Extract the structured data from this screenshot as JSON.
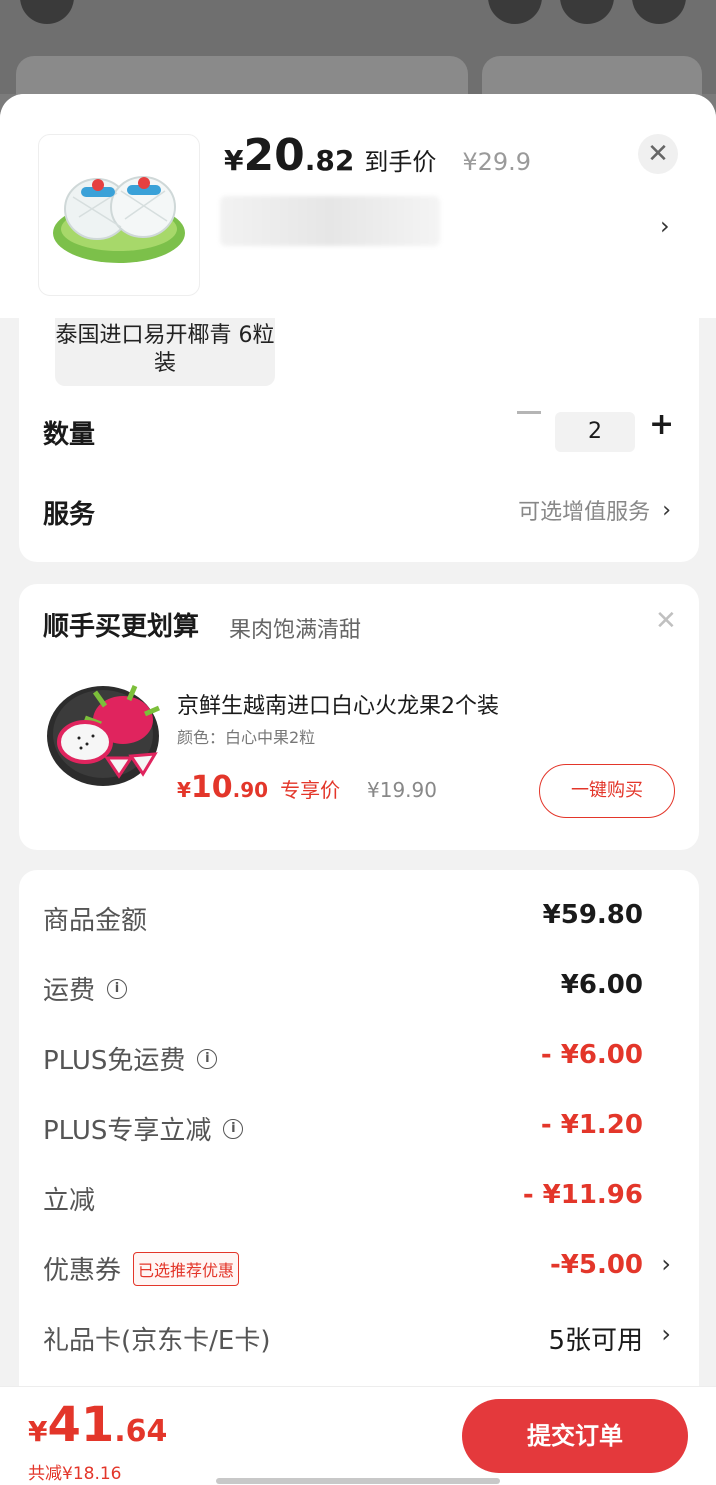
{
  "product": {
    "price_int": "20",
    "price_decimal": ".82",
    "price_currency": "¥",
    "price_desc": "到手价",
    "original_price": "¥29.9",
    "spec": "泰国进口易开椰青 6粒装"
  },
  "order": {
    "quantity_label": "数量",
    "quantity_value": "2",
    "service_label": "服务",
    "service_value": "可选增值服务"
  },
  "recommend": {
    "title": "顺手买更划算",
    "subtitle": "果肉饱满清甜",
    "item_name": "京鲜生越南进口白心火龙果2个装",
    "item_color": "颜色：白心中果2粒",
    "price_currency": "¥",
    "price_int": "10",
    "price_decimal": ".90",
    "price_tag": "专享价",
    "original_price": "¥19.90",
    "buy_label": "一键购买"
  },
  "fees": {
    "goods_label": "商品金额",
    "goods_value": "¥59.80",
    "shipping_label": "运费",
    "shipping_value": "¥6.00",
    "plus_free_label": "PLUS免运费",
    "plus_free_value": "- ¥6.00",
    "plus_discount_label": "PLUS专享立减",
    "plus_discount_value": "- ¥1.20",
    "discount_label": "立减",
    "discount_value": "- ¥11.96",
    "coupon_label": "优惠券",
    "coupon_tag": "已选推荐优惠",
    "coupon_value": "-¥5.00",
    "giftcard_label": "礼品卡(京东卡/E卡)",
    "giftcard_value": "5张可用"
  },
  "bottom": {
    "total_currency": "¥",
    "total_int": "41",
    "total_decimal": ".64",
    "saved": "共减¥18.16",
    "submit_label": "提交订单"
  },
  "colors": {
    "accent": "#e3362a",
    "submit": "#e4393c"
  }
}
